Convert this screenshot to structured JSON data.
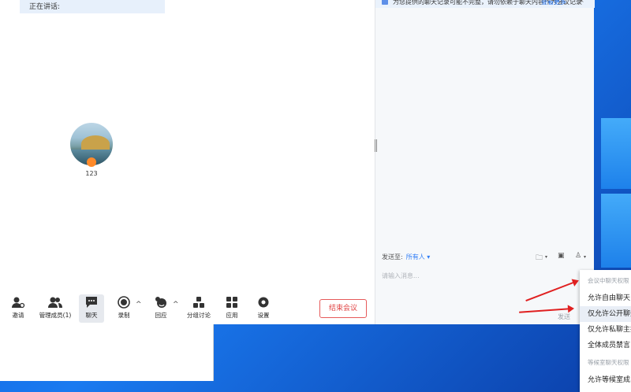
{
  "meeting": {
    "speaking_label": "正在讲话:",
    "participant_name": "123",
    "end_button": "结束会议"
  },
  "toolbar": {
    "items": [
      {
        "label": "邀请",
        "icon": "invite-icon"
      },
      {
        "label": "管理成员(1)",
        "icon": "members-icon"
      },
      {
        "label": "聊天",
        "icon": "chat-icon"
      },
      {
        "label": "录制",
        "icon": "record-icon"
      },
      {
        "label": "回应",
        "icon": "reaction-icon"
      },
      {
        "label": "分组讨论",
        "icon": "breakout-icon"
      },
      {
        "label": "应用",
        "icon": "apps-icon"
      },
      {
        "label": "设置",
        "icon": "settings-icon"
      }
    ]
  },
  "chat": {
    "notice_text": "为您提供的聊天记录可能不完整，请勿依赖于聊天内容作为会议记录",
    "notice_more": "查看更多",
    "send_to_label": "发送至:",
    "send_to_target": "所有人",
    "input_placeholder": "请输入消息...",
    "send_label": "发送"
  },
  "dropdown": {
    "items": [
      {
        "label": "会议中聊天权限",
        "type": "header"
      },
      {
        "label": "允许自由聊天",
        "type": "option"
      },
      {
        "label": "仅允许公开聊天",
        "type": "option",
        "selected": true
      },
      {
        "label": "仅允许私聊主持人",
        "type": "option"
      },
      {
        "label": "全体成员禁言",
        "type": "option"
      },
      {
        "label": "等候室聊天权限",
        "type": "header"
      },
      {
        "label": "允许等候室成员私聊主持人",
        "type": "option"
      }
    ]
  },
  "colors": {
    "accent": "#2f7df6",
    "end_button": "#e04444",
    "annotation_arrow": "#e02020"
  }
}
